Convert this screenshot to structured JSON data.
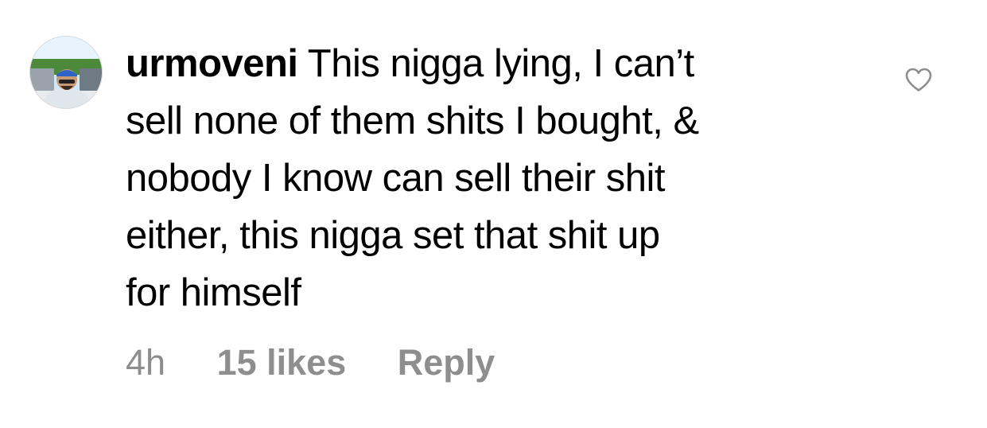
{
  "comment": {
    "username": "urmoveni",
    "text_lines": [
      "This nigga lying, I can’t",
      "sell none of them shits I bought, &",
      "nobody I know can sell their shit",
      "either, this nigga set that shit up",
      "for himself"
    ],
    "time": "4h",
    "likes": "15 likes",
    "reply_label": "Reply",
    "like_icon": "heart-outline-icon"
  }
}
